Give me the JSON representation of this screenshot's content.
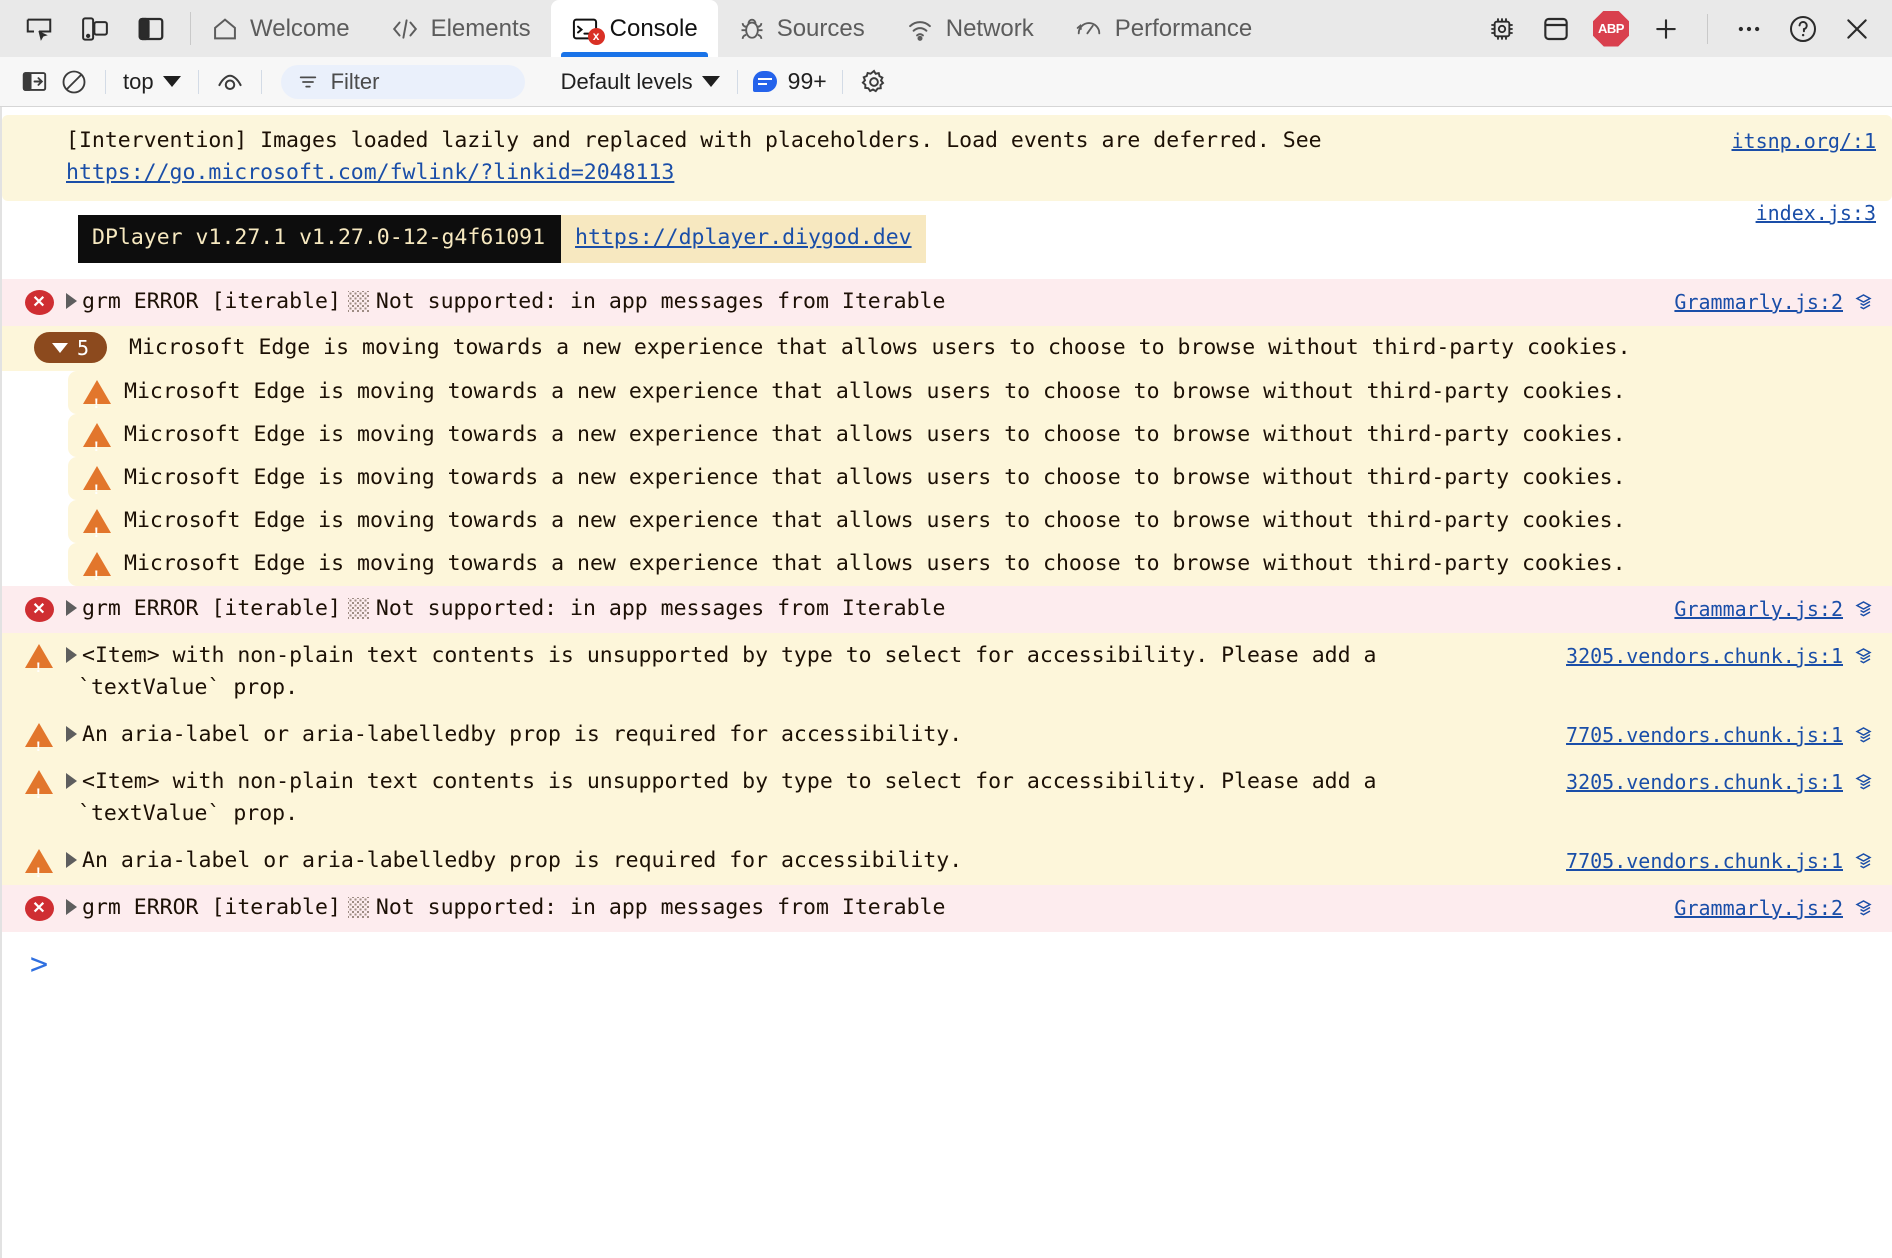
{
  "window": {
    "left_icons": [
      "inspect-element-icon",
      "device-toolbar-icon",
      "dock-side-icon"
    ],
    "right_icons": [
      "more-options-icon",
      "help-icon",
      "close-icon"
    ]
  },
  "tabs": [
    {
      "label": "Welcome",
      "icon": "home-icon",
      "active": false
    },
    {
      "label": "Elements",
      "icon": "code-brackets-icon",
      "active": false
    },
    {
      "label": "Console",
      "icon": "console-prompt-icon",
      "active": true,
      "error_badge": "x"
    },
    {
      "label": "Sources",
      "icon": "bug-icon",
      "active": false
    },
    {
      "label": "Network",
      "icon": "wifi-icon",
      "active": false
    },
    {
      "label": "Performance",
      "icon": "gauge-icon",
      "active": false
    }
  ],
  "tab_extras": {
    "memory_icon": "chip-icon",
    "application_icon": "app-panel-icon",
    "adblock_label": "ABP",
    "add_tab_label": "+"
  },
  "filterbar": {
    "sidebar_toggle_icon": "show-console-sidebar-icon",
    "clear_icon": "clear-console-icon",
    "context_label": "top",
    "live_expression_icon": "eye-icon",
    "filter_icon": "filter-icon",
    "filter_placeholder": "Filter",
    "filter_value": "",
    "levels_label": "Default levels",
    "issues_count": "99+",
    "issues_icon": "issues-bubble-icon",
    "settings_icon": "gear-icon"
  },
  "console": {
    "messages": [
      {
        "type": "intervention",
        "text": "[Intervention] Images loaded lazily and replaced with placeholders. Load events are deferred. See",
        "link": "https://go.microsoft.com/fwlink/?linkid=2048113",
        "source": "itsnp.org/:1"
      },
      {
        "type": "dplayer",
        "badge_text": "DPlayer v1.27.1 v1.27.0-12-g4f61091",
        "badge_link": "https://dplayer.diygod.dev",
        "source": "index.js:3"
      },
      {
        "type": "error",
        "prefix": "grm ERROR [iterable]",
        "text": "Not supported: in app messages from Iterable",
        "source": "Grammarly.js:2",
        "stack_icon": "stack-frames-icon"
      },
      {
        "type": "group",
        "count": "5",
        "text": "Microsoft Edge is moving towards a new experience that allows users to choose to browse without third-party cookies."
      },
      {
        "type": "group-warning",
        "text": "Microsoft Edge is moving towards a new experience that allows users to choose to browse without third-party cookies."
      },
      {
        "type": "group-warning",
        "text": "Microsoft Edge is moving towards a new experience that allows users to choose to browse without third-party cookies."
      },
      {
        "type": "group-warning",
        "text": "Microsoft Edge is moving towards a new experience that allows users to choose to browse without third-party cookies."
      },
      {
        "type": "group-warning",
        "text": "Microsoft Edge is moving towards a new experience that allows users to choose to browse without third-party cookies."
      },
      {
        "type": "group-warning",
        "text": "Microsoft Edge is moving towards a new experience that allows users to choose to browse without third-party cookies."
      },
      {
        "type": "error",
        "prefix": "grm ERROR [iterable]",
        "text": "Not supported: in app messages from Iterable",
        "source": "Grammarly.js:2",
        "stack_icon": "stack-frames-icon"
      },
      {
        "type": "warning",
        "line1": "<Item> with non-plain text contents is unsupported by type to select for accessibility. Please add a",
        "line2": "`textValue` prop.",
        "source": "3205.vendors.chunk.js:1",
        "stack_icon": "stack-frames-icon"
      },
      {
        "type": "warning",
        "line1": "An aria-label or aria-labelledby prop is required for accessibility.",
        "line2": "",
        "source": "7705.vendors.chunk.js:1",
        "stack_icon": "stack-frames-icon"
      },
      {
        "type": "warning",
        "line1": "<Item> with non-plain text contents is unsupported by type to select for accessibility. Please add a",
        "line2": "`textValue` prop.",
        "source": "3205.vendors.chunk.js:1",
        "stack_icon": "stack-frames-icon"
      },
      {
        "type": "warning",
        "line1": "An aria-label or aria-labelledby prop is required for accessibility.",
        "line2": "",
        "source": "7705.vendors.chunk.js:1",
        "stack_icon": "stack-frames-icon"
      },
      {
        "type": "error",
        "prefix": "grm ERROR [iterable]",
        "text": "Not supported: in app messages from Iterable",
        "source": "Grammarly.js:2",
        "stack_icon": "stack-frames-icon"
      }
    ],
    "prompt_symbol": ">",
    "prompt_value": ""
  },
  "colors": {
    "error_bg": "#fdecee",
    "warning_bg": "#fdf6da",
    "accent_blue": "#1a73e8",
    "link_blue": "#1a4ea8",
    "warning_orange": "#e2762c",
    "error_red": "#cf2e32",
    "group_brown": "#8c4a1e"
  }
}
